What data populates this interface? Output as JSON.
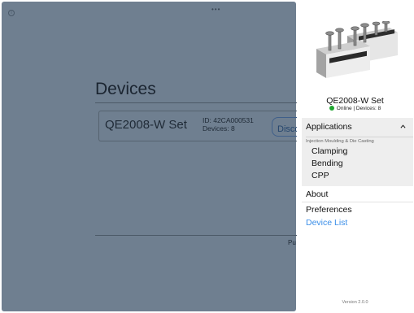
{
  "background": {
    "dots": "•••",
    "page_title": "Devices",
    "device_card": {
      "name": "QE2008-W Set",
      "id_line": "ID: 42CA000531",
      "devices_line": "Devices: 8",
      "button_label": "Disconnect"
    },
    "footer_fragment": "Pu"
  },
  "panel": {
    "device_name": "QE2008-W Set",
    "status": "Online | Devices: 8",
    "status_color": "#1fa52f",
    "applications": {
      "header": "Applications",
      "category": "Injection Moulding & Die Casting",
      "items": [
        "Clamping",
        "Bending",
        "CPP"
      ]
    },
    "menu": {
      "about": "About",
      "preferences": "Preferences",
      "device_list": "Device List"
    },
    "version": "Version 2.0.0"
  },
  "colors": {
    "overlay": "#6f7f90",
    "link": "#3a8ee8",
    "submenu_bg": "#eeeeee"
  },
  "icons": {
    "info": "info-icon",
    "chevron": "chevron-up-icon"
  }
}
